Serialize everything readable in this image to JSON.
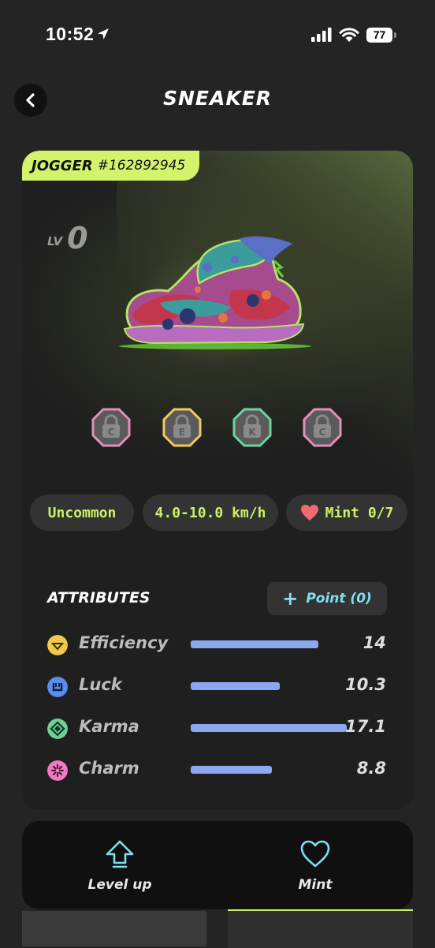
{
  "status_bar": {
    "time": "10:52",
    "battery": "77"
  },
  "header": {
    "title": "SNEAKER"
  },
  "sneaker": {
    "type": "JOGGER",
    "id": "#162892945",
    "level_label": "LV",
    "level_value": "0",
    "sockets": [
      {
        "letter": "C",
        "color": "#e28fb6"
      },
      {
        "letter": "E",
        "color": "#f3c95a"
      },
      {
        "letter": "K",
        "color": "#6fd3a1"
      },
      {
        "letter": "C",
        "color": "#e28fb6"
      }
    ],
    "rarity": "Uncommon",
    "speed": "4.0-10.0 km/h",
    "mint": "Mint 0/7"
  },
  "attributes": {
    "heading": "ATTRIBUTES",
    "point_button": "Point (0)",
    "items": [
      {
        "name": "Efficiency",
        "value": "14",
        "level": 0.82,
        "icon": "efficiency-icon",
        "color": "#f2c94c"
      },
      {
        "name": "Luck",
        "value": "10.3",
        "level": 0.57,
        "icon": "luck-icon",
        "color": "#5b8def"
      },
      {
        "name": "Karma",
        "value": "17.1",
        "level": 1.0,
        "icon": "karma-icon",
        "color": "#6fcf97"
      },
      {
        "name": "Charm",
        "value": "8.8",
        "level": 0.52,
        "icon": "charm-icon",
        "color": "#f07ac0"
      }
    ]
  },
  "actions": {
    "level_up": "Level up",
    "mint": "Mint"
  }
}
